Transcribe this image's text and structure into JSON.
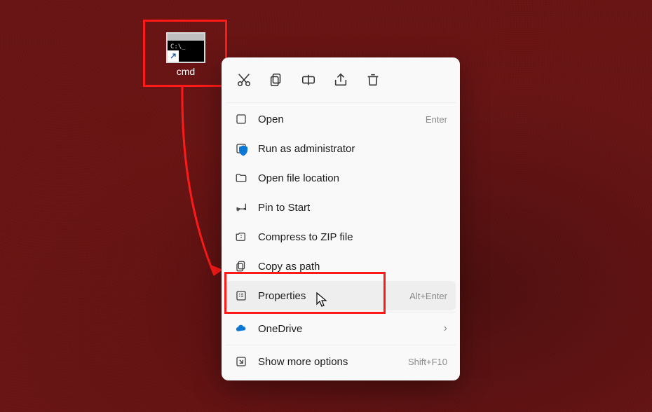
{
  "desktop": {
    "icon_label": "cmd",
    "prompt_text": "C:\\_"
  },
  "context_menu": {
    "top_actions": [
      "cut",
      "copy",
      "rename",
      "share",
      "delete"
    ],
    "items": [
      {
        "label": "Open",
        "shortcut": "Enter",
        "icon": "open"
      },
      {
        "label": "Run as administrator",
        "shortcut": "",
        "icon": "admin"
      },
      {
        "label": "Open file location",
        "shortcut": "",
        "icon": "folder"
      },
      {
        "label": "Pin to Start",
        "shortcut": "",
        "icon": "pin"
      },
      {
        "label": "Compress to ZIP file",
        "shortcut": "",
        "icon": "zip"
      },
      {
        "label": "Copy as path",
        "shortcut": "",
        "icon": "copypath"
      },
      {
        "label": "Properties",
        "shortcut": "Alt+Enter",
        "icon": "properties"
      },
      {
        "label": "OneDrive",
        "shortcut": "",
        "icon": "onedrive",
        "chevron": true
      },
      {
        "label": "Show more options",
        "shortcut": "Shift+F10",
        "icon": "more"
      }
    ]
  },
  "colors": {
    "annotation": "#ff1a1a",
    "menu_bg": "#f9f9f9",
    "onedrive": "#0a78d4"
  }
}
